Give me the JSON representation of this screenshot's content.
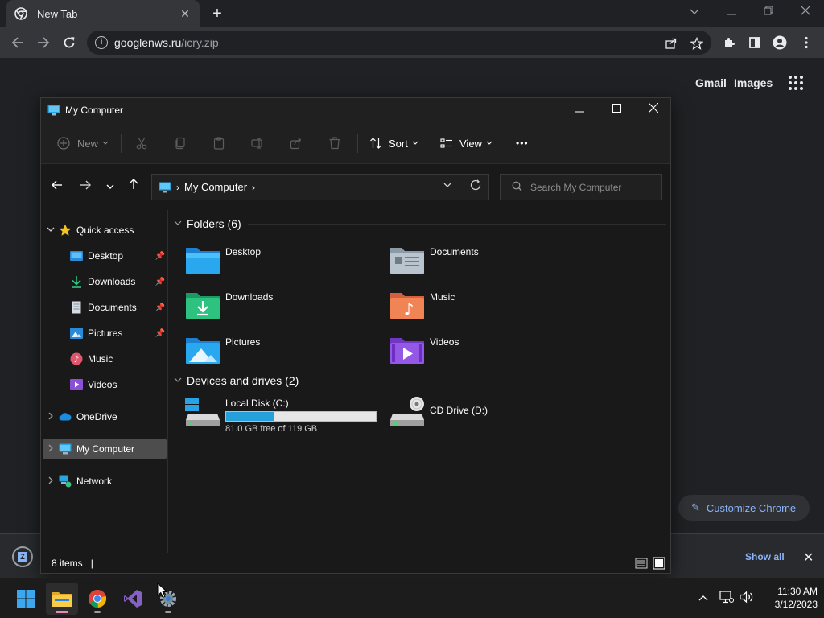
{
  "browser": {
    "tab_title": "New Tab",
    "tab_close": "✕",
    "new_tab": "+",
    "url_host": "googlenws.ru",
    "url_path": "/icry.zip",
    "ntp_links": [
      "Gmail",
      "Images"
    ],
    "customize_label": "Customize Chrome",
    "download_bar": {
      "show_all": "Show all",
      "close": "✕"
    }
  },
  "explorer": {
    "title": "My Computer",
    "commands": {
      "new": "New",
      "sort": "Sort",
      "view": "View",
      "more": "•••"
    },
    "address": {
      "crumb": "My Computer"
    },
    "search_placeholder": "Search My Computer",
    "sidebar": [
      {
        "label": "Quick access",
        "icon": "star-icon"
      },
      {
        "label": "Desktop",
        "icon": "desktop-folder-icon",
        "pinned": true
      },
      {
        "label": "Downloads",
        "icon": "download-icon",
        "pinned": true
      },
      {
        "label": "Documents",
        "icon": "document-icon",
        "pinned": true
      },
      {
        "label": "Pictures",
        "icon": "pictures-icon",
        "pinned": true
      },
      {
        "label": "Music",
        "icon": "music-icon"
      },
      {
        "label": "Videos",
        "icon": "videos-icon"
      },
      {
        "label": "OneDrive",
        "icon": "cloud-icon"
      },
      {
        "label": "My Computer",
        "icon": "computer-icon",
        "selected": true
      },
      {
        "label": "Network",
        "icon": "network-icon"
      }
    ],
    "groups": {
      "folders_header": "Folders (6)",
      "drives_header": "Devices and drives (2)"
    },
    "folders": [
      "Desktop",
      "Documents",
      "Downloads",
      "Music",
      "Pictures",
      "Videos"
    ],
    "drives": {
      "local": {
        "name": "Local Disk (C:)",
        "free_text": "81.0 GB free of 119 GB",
        "used_fraction": 0.32
      },
      "cd": {
        "name": "CD Drive (D:)"
      }
    },
    "status": "8 items"
  },
  "taskbar": {
    "time": "11:30 AM",
    "date": "3/12/2023"
  },
  "colors": {
    "accent_blue": "#8ab4f8",
    "drive_fill": "#26a0da",
    "folder_blue": "#1e90e0"
  }
}
